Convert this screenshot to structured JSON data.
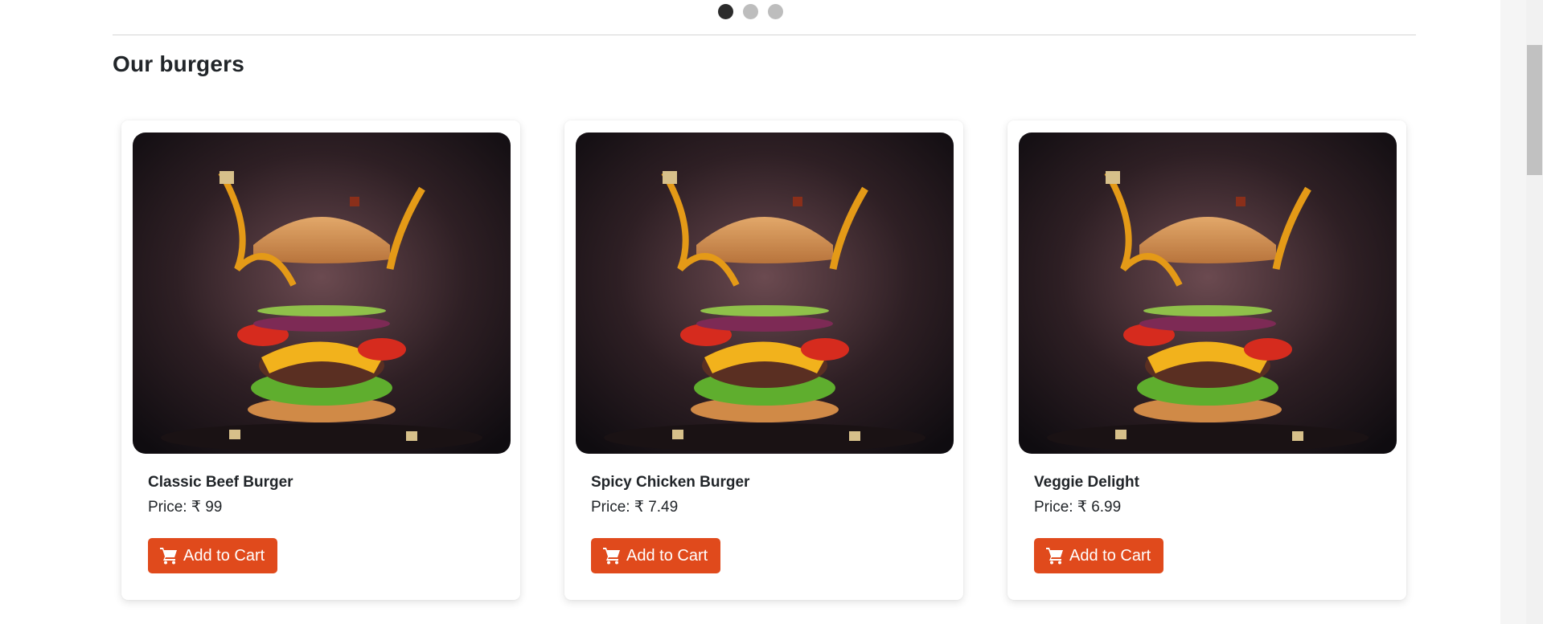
{
  "carousel": {
    "slides": 3,
    "active_index": 0
  },
  "section": {
    "title": "Our burgers"
  },
  "products": [
    {
      "name": "Classic Beef Burger",
      "price_text": "Price: ₹ 99",
      "button_label": "Add to Cart",
      "image": "burger-photo"
    },
    {
      "name": "Spicy Chicken Burger",
      "price_text": "Price: ₹ 7.49",
      "button_label": "Add to Cart",
      "image": "burger-photo"
    },
    {
      "name": "Veggie Delight",
      "price_text": "Price: ₹ 6.99",
      "button_label": "Add to Cart",
      "image": "burger-photo"
    }
  ],
  "icons": {
    "cart": "shopping-cart-icon"
  },
  "colors": {
    "accent": "#e04a1c",
    "dot_active": "#2b2b2b",
    "dot_inactive": "#bdbdbd"
  }
}
